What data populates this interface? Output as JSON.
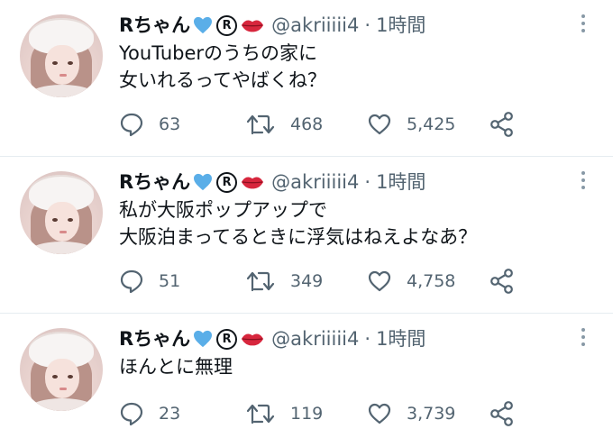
{
  "colors": {
    "name": "#0f1419",
    "secondary": "#536471",
    "heart": "#5aaee8",
    "lips": "#d7263d",
    "divider": "#e6ecf0"
  },
  "tweets": [
    {
      "name": "Rちゃん",
      "handle": "@akriiiii4",
      "separator": "·",
      "time": "1時間",
      "text": [
        "YouTuberのうちの家に",
        "女いれるってやばくね？"
      ],
      "replies": "63",
      "retweets": "468",
      "likes": "5,425"
    },
    {
      "name": "Rちゃん",
      "handle": "@akriiiii4",
      "separator": "·",
      "time": "1時間",
      "text": [
        "私が大阪ポップアップで",
        "大阪泊まってるときに浮気はねえよなあ？"
      ],
      "replies": "51",
      "retweets": "349",
      "likes": "4,758"
    },
    {
      "name": "Rちゃん",
      "handle": "@akriiiii4",
      "separator": "·",
      "time": "1時間",
      "text": [
        "ほんとに無理"
      ],
      "replies": "23",
      "retweets": "119",
      "likes": "3,739"
    }
  ],
  "icons": {
    "reg_symbol": "R",
    "reply": "reply-icon",
    "retweet": "retweet-icon",
    "like": "like-icon",
    "share": "share-icon",
    "more": "more-icon"
  }
}
